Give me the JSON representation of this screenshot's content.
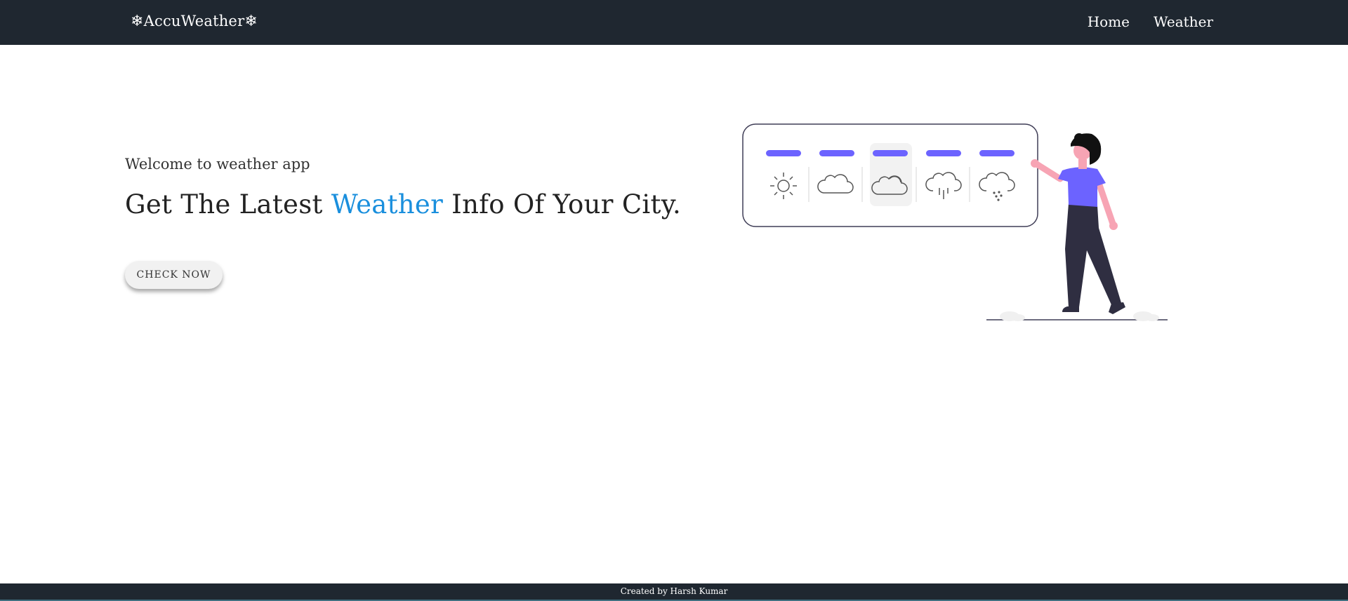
{
  "navbar": {
    "brand_flake_left": "❄",
    "brand_name": "AccuWeather",
    "brand_flake_right": "❄",
    "links": [
      {
        "label": "Home"
      },
      {
        "label": "Weather"
      }
    ]
  },
  "hero": {
    "welcome": "Welcome to weather app",
    "headline_pre": "Get The Latest ",
    "headline_accent": "Weather",
    "headline_post": " Info Of Your City.",
    "cta_label": "CHECK NOW"
  },
  "illustration": {
    "forecast_icons": [
      "sun-icon",
      "cloud-icon",
      "cloud-sun-icon",
      "rain-icon",
      "snow-icon"
    ],
    "selected_index": 2,
    "accent_color": "#6c63ff",
    "figure": "woman-pointing-at-board"
  },
  "footer": {
    "credit": "Created by Harsh Kumar"
  },
  "colors": {
    "navbar_bg": "#1f2730",
    "headline_accent": "#1a8fdd",
    "illustration_accent": "#6c63ff",
    "pants": "#2f2e41",
    "skin": "#f7a4b4"
  }
}
